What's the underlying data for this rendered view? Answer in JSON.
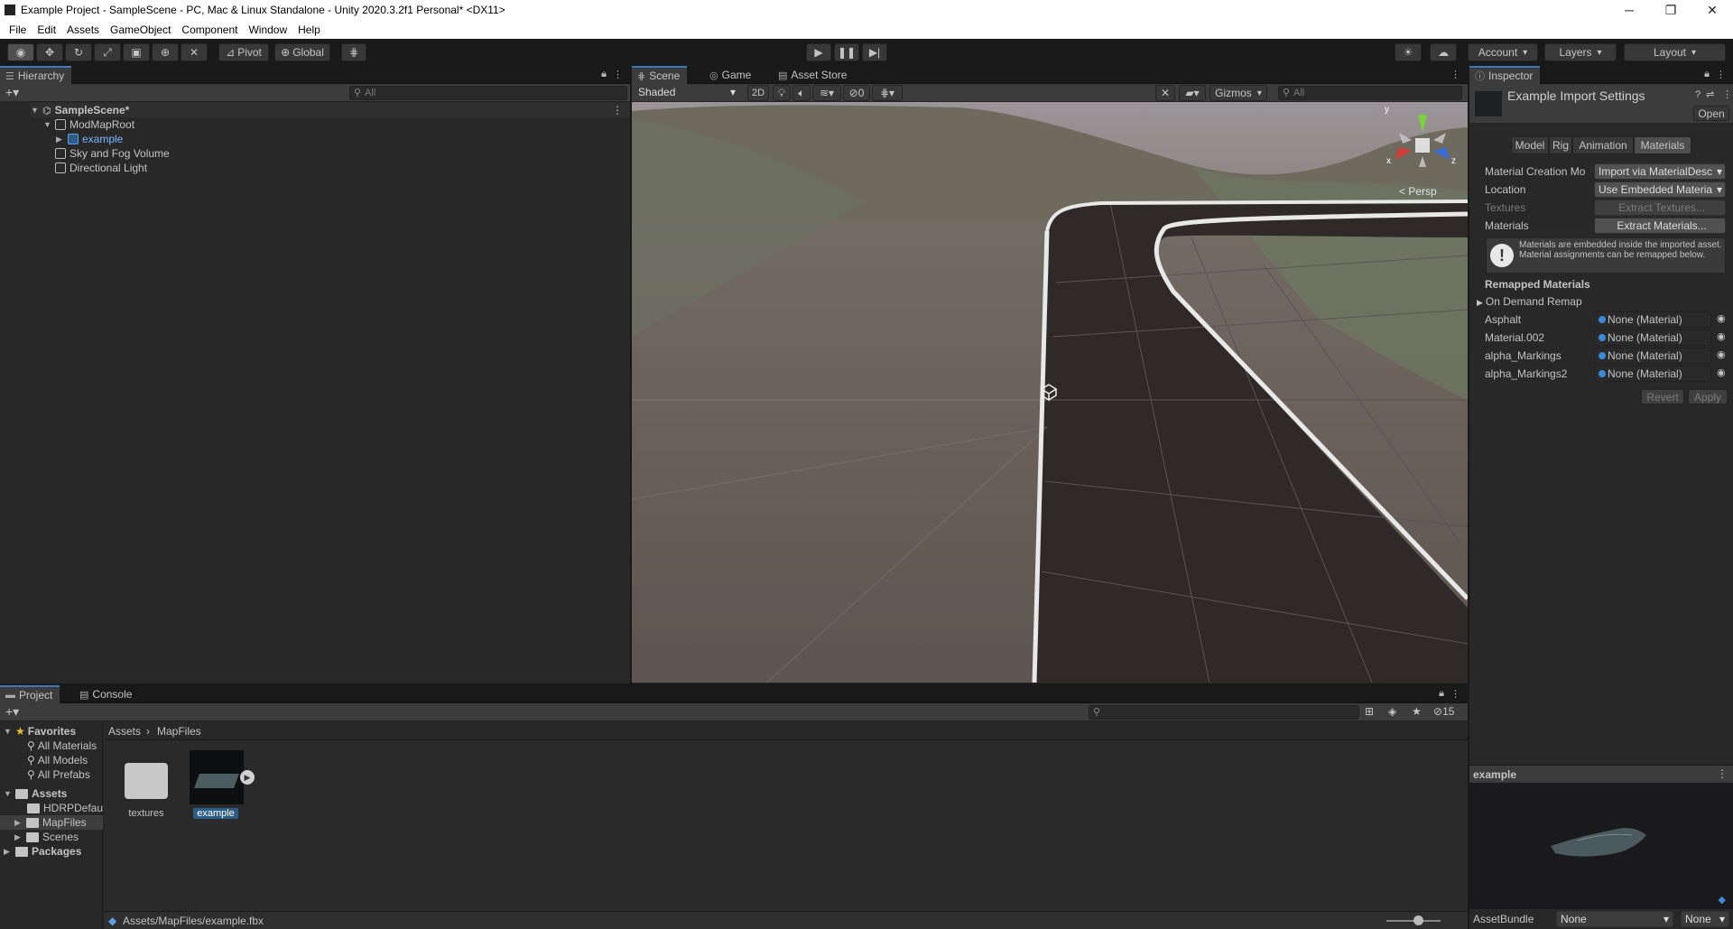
{
  "window": {
    "title": "Example Project - SampleScene - PC, Mac & Linux Standalone - Unity 2020.3.2f1 Personal* <DX11>",
    "controls": [
      "─",
      "❐",
      "✕"
    ]
  },
  "menubar": [
    "File",
    "Edit",
    "Assets",
    "GameObject",
    "Component",
    "Window",
    "Help"
  ],
  "toolbar": {
    "pivot_label": "Pivot",
    "global_label": "Global",
    "account_label": "Account",
    "layers_label": "Layers",
    "layout_label": "Layout"
  },
  "hierarchy": {
    "tab_label": "Hierarchy",
    "search_placeholder": "All",
    "items": [
      {
        "label": "SampleScene*"
      },
      {
        "label": "ModMapRoot"
      },
      {
        "label": "example"
      },
      {
        "label": "Sky and Fog Volume"
      },
      {
        "label": "Directional Light"
      }
    ]
  },
  "scene": {
    "tabs": [
      "Scene",
      "Game",
      "Asset Store"
    ],
    "shading_mode": "Shaded",
    "mode_2d": "2D",
    "hidden_count": "0",
    "gizmos_label": "Gizmos",
    "search_placeholder": "All",
    "persp_label": "< Persp",
    "axis_labels": {
      "x": "x",
      "y": "y",
      "z": "z"
    }
  },
  "inspector": {
    "tab_label": "Inspector",
    "asset_title": "Example Import Settings",
    "open_button": "Open",
    "tabs": [
      "Model",
      "Rig",
      "Animation",
      "Materials"
    ],
    "rows": {
      "material_creation_label": "Material Creation Mo",
      "material_creation_value": "Import via MaterialDesc",
      "location_label": "Location",
      "location_value": "Use Embedded Materia",
      "textures_label": "Textures",
      "textures_button": "Extract Textures...",
      "materials_label": "Materials",
      "materials_button": "Extract Materials..."
    },
    "info_text": "Materials are embedded inside the imported asset. Material assignments can be remapped below.",
    "remapped_header": "Remapped Materials",
    "on_demand_label": "On Demand Remap",
    "remaps": [
      {
        "name": "Asphalt",
        "value": "None (Material)"
      },
      {
        "name": "Material.002",
        "value": "None (Material)"
      },
      {
        "name": "alpha_Markings",
        "value": "None (Material)"
      },
      {
        "name": "alpha_Markings2",
        "value": "None (Material)"
      }
    ],
    "revert_button": "Revert",
    "apply_button": "Apply",
    "preview_title": "example",
    "assetbundle_label": "AssetBundle",
    "assetbundle_value": "None",
    "assetbundle_variant": "None"
  },
  "project": {
    "tabs": [
      "Project",
      "Console"
    ],
    "hidden_count": "15",
    "favorites_label": "Favorites",
    "favorites": [
      "All Materials",
      "All Models",
      "All Prefabs"
    ],
    "assets_label": "Assets",
    "asset_folders": [
      "HDRPDefau",
      "MapFiles",
      "Scenes"
    ],
    "packages_label": "Packages",
    "breadcrumb": [
      "Assets",
      "MapFiles"
    ],
    "grid_items": [
      {
        "label": "textures"
      },
      {
        "label": "example"
      }
    ],
    "status_path": "Assets/MapFiles/example.fbx"
  },
  "colors": {
    "accent": "#3a79bb",
    "selection": "#2c5d87",
    "panel_bg": "#282828",
    "dark_bg": "#191919"
  }
}
